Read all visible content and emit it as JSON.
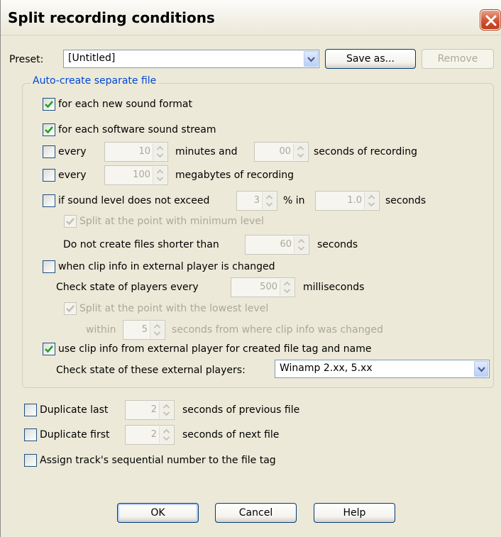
{
  "window": {
    "title": "Split recording conditions"
  },
  "preset": {
    "label": "Preset:",
    "value": "[Untitled]",
    "save_as": "Save as...",
    "remove": "Remove"
  },
  "group": {
    "title": "Auto-create separate file",
    "new_sound_format": "for each new sound format",
    "software_stream": "for each software sound stream",
    "every_time": {
      "label": "every",
      "minutes": "10",
      "minutes_label": "minutes and",
      "seconds": "00",
      "seconds_label": "seconds of recording"
    },
    "every_size": {
      "label": "every",
      "megabytes": "100",
      "megabytes_label": "megabytes of recording"
    },
    "sound_level": {
      "label": "if sound level does not exceed",
      "percent": "3",
      "percent_label": "% in",
      "seconds": "1.0",
      "seconds_label": "seconds",
      "split_min_label": "Split at the point with minimum level",
      "shorter_label": "Do not create files shorter than",
      "shorter_value": "60",
      "shorter_unit": "seconds"
    },
    "clip_info": {
      "label": "when clip info in external player is changed",
      "check_label": "Check state of players every",
      "check_value": "500",
      "check_unit": "milliseconds",
      "split_lowest_label": "Split at the point with the lowest level",
      "within_label": "within",
      "within_value": "5",
      "within_unit": "seconds from where clip info was changed"
    },
    "use_clip_info": {
      "label": "use clip info from external player for created file tag and name",
      "players_label": "Check state of these external players:",
      "players_value": "Winamp 2.xx, 5.xx"
    }
  },
  "duplicate_last": {
    "label": "Duplicate last",
    "value": "2",
    "unit": "seconds of previous file"
  },
  "duplicate_first": {
    "label": "Duplicate first",
    "value": "2",
    "unit": "seconds of next file"
  },
  "assign_track": {
    "label": "Assign track's sequential number to the file tag"
  },
  "buttons": {
    "ok": "OK",
    "cancel": "Cancel",
    "help": "Help"
  },
  "checked": {
    "new_sound_format": true,
    "software_stream": true,
    "every_time": false,
    "every_size": false,
    "sound_level": false,
    "split_min": true,
    "clip_info": false,
    "split_lowest": true,
    "use_clip_info": true,
    "duplicate_last": false,
    "duplicate_first": false,
    "assign_track": false
  },
  "colors": {
    "group_title": "#0046d5",
    "dialog_bg": "#ece9d8",
    "check": "#21a121"
  }
}
